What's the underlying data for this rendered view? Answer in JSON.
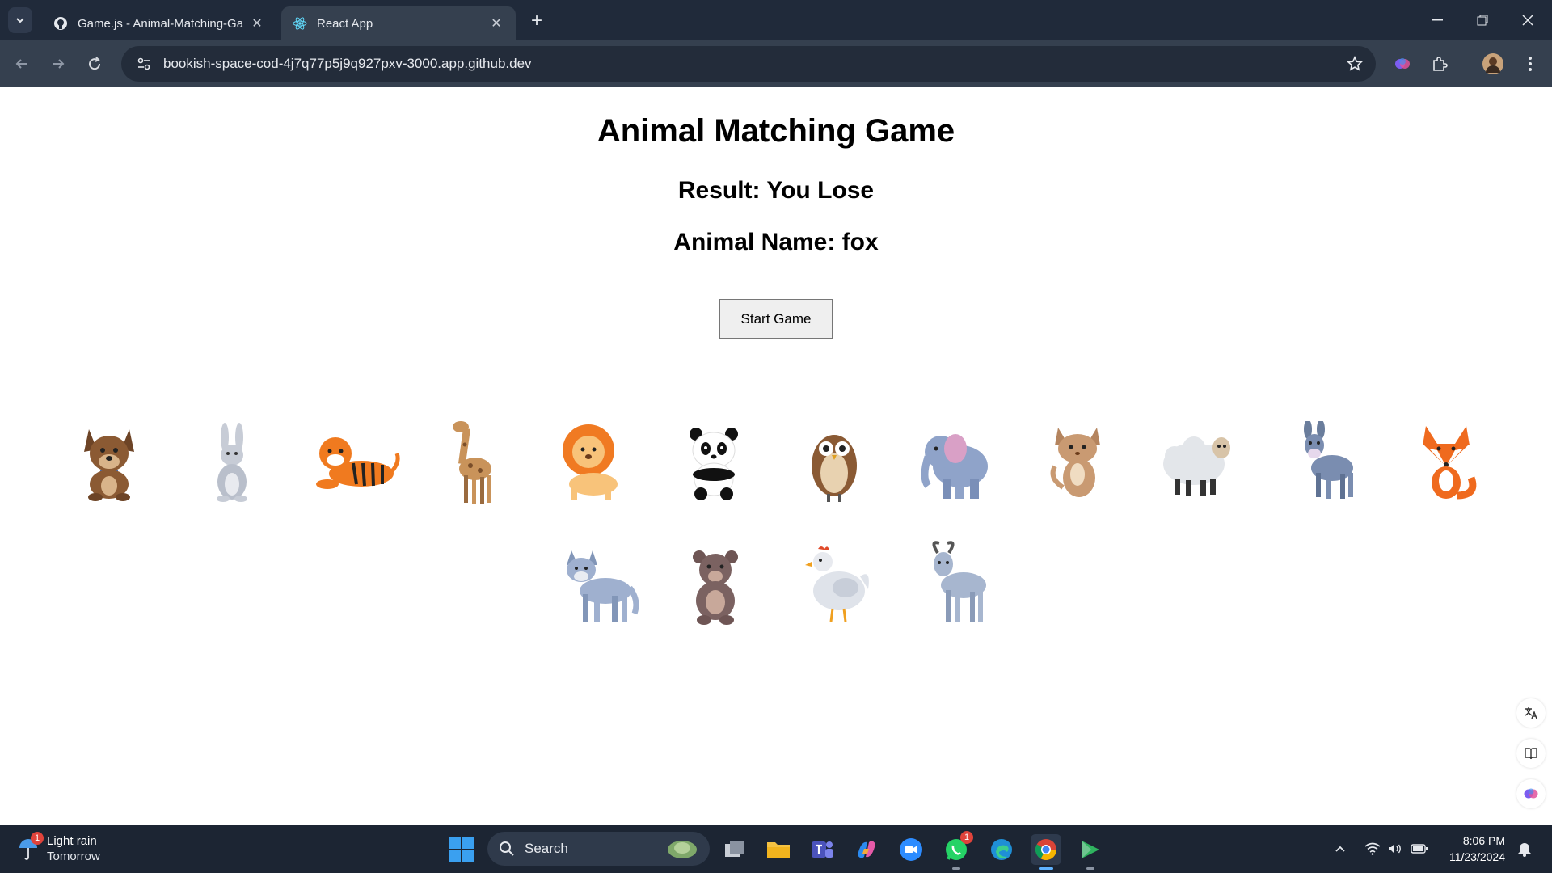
{
  "browser": {
    "tabs": [
      {
        "title": "Game.js - Animal-Matching-Ga",
        "active": false
      },
      {
        "title": "React App",
        "active": true
      }
    ],
    "url": "bookish-space-cod-4j7q77p5j9q927pxv-3000.app.github.dev"
  },
  "page": {
    "title": "Animal Matching Game",
    "result": "Result: You Lose",
    "animal_name": "Animal Name: fox",
    "start_button": "Start Game",
    "animals": [
      "dog",
      "rabbit",
      "tiger",
      "giraffe",
      "lion",
      "panda",
      "owl",
      "elephant",
      "cat",
      "sheep",
      "donkey",
      "fox",
      "wolf",
      "bear",
      "chicken",
      "goat"
    ]
  },
  "taskbar": {
    "weather_title": "Light rain",
    "weather_sub": "Tomorrow",
    "weather_badge": "1",
    "search_label": "Search",
    "whatsapp_badge": "1",
    "time": "8:06 PM",
    "date": "11/23/2024"
  },
  "colors": {
    "tabbar": "#202a3a",
    "toolbar": "#35404f",
    "taskbar": "#1c2533"
  }
}
